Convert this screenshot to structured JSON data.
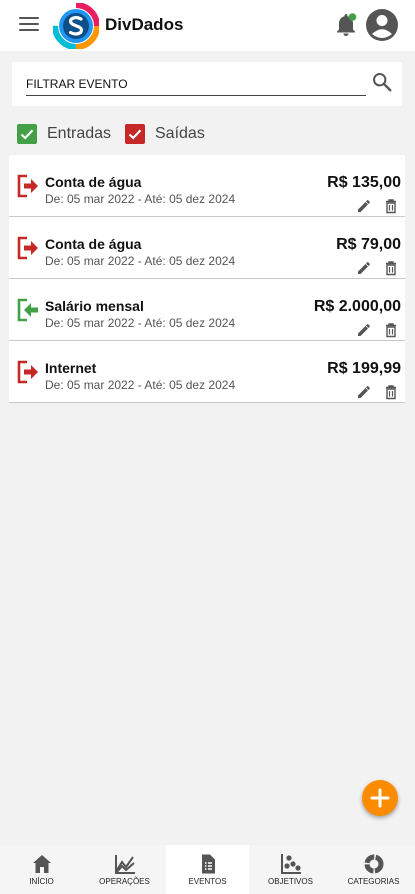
{
  "app": {
    "title": "DivDados",
    "colors": {
      "accent": "#fb8c00",
      "income": "#43a047",
      "expense": "#c62828"
    }
  },
  "header": {
    "icons": [
      "menu-icon",
      "app-logo",
      "bell-icon",
      "account-icon"
    ]
  },
  "filter": {
    "placeholder": "FILTRAR EVENTO",
    "value": ""
  },
  "filters": {
    "income": {
      "label": "Entradas",
      "checked": true
    },
    "expense": {
      "label": "Saídas",
      "checked": true
    }
  },
  "events": [
    {
      "type": "expense",
      "name": "Conta de água",
      "dates": "De: 05 mar 2022 - Até: 05 dez 2024",
      "value": "R$ 135,00"
    },
    {
      "type": "expense",
      "name": "Conta de água",
      "dates": "De: 05 mar 2022 - Até: 05 dez 2024",
      "value": "R$ 79,00"
    },
    {
      "type": "income",
      "name": "Salário mensal",
      "dates": "De: 05 mar 2022 - Até: 05 dez 2024",
      "value": "R$ 2.000,00"
    },
    {
      "type": "expense",
      "name": "Internet",
      "dates": "De: 05 mar 2022 - Até: 05 dez 2024",
      "value": "R$ 199,99"
    }
  ],
  "nav": {
    "items": [
      {
        "label": "INÍCIO",
        "icon": "home-icon",
        "active": false
      },
      {
        "label": "OPERAÇÕES",
        "icon": "chart-icon",
        "active": false
      },
      {
        "label": "EVENTOS",
        "icon": "document-icon",
        "active": true
      },
      {
        "label": "OBJETIVOS",
        "icon": "scatter-icon",
        "active": false
      },
      {
        "label": "CATEGORIAS",
        "icon": "categories-icon",
        "active": false
      }
    ]
  }
}
